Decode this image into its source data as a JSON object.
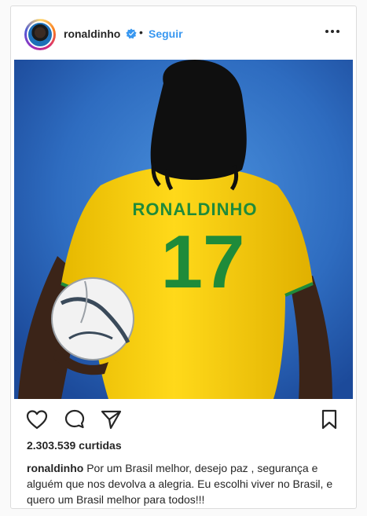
{
  "post": {
    "username": "ronaldinho",
    "follow_label": "Seguir",
    "separator": "•",
    "likes": "2.303.539 curtidas",
    "caption_user": "ronaldinho",
    "caption_text": "Por um Brasil melhor, desejo paz , segurança e alguém que nos devolva a alegria. Eu escolhi viver no Brasil, e quero um Brasil melhor para todos!!!",
    "jersey_name": "RONALDINHO",
    "jersey_number": "17"
  },
  "colors": {
    "follow": "#3897f0",
    "verified": "#3897f0",
    "jersey": "#f5d000",
    "jersey_text": "#1f8b3a",
    "background": "#2f6fc4"
  },
  "icons": [
    "verified-badge-icon",
    "more-options-icon",
    "heart-icon",
    "comment-icon",
    "share-icon",
    "bookmark-icon"
  ]
}
